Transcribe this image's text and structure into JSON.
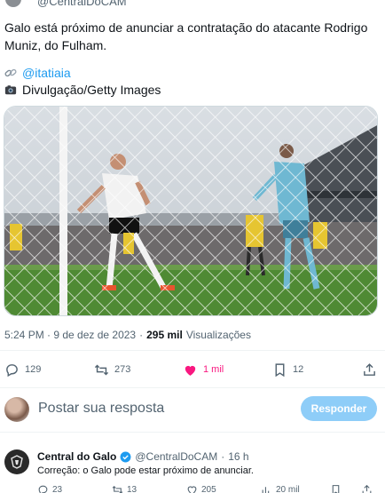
{
  "top": {
    "handle": "@CentralDoCAM"
  },
  "tweet": {
    "text": "Galo está próximo de anunciar a contratação do atacante Rodrigo Muniz, do Fulham.",
    "credit_link": "@itatiaia",
    "credit_photo": "Divulgação/Getty Images",
    "time": "5:24 PM · 9 de dez de 2023",
    "separator": "·",
    "views_count": "295 mil",
    "views_label": "Visualizações"
  },
  "actions": {
    "replies": "129",
    "retweets": "273",
    "likes": "1 mil",
    "bookmarks": "12"
  },
  "reply_box": {
    "placeholder": "Postar sua resposta",
    "button_label": "Responder"
  },
  "reply_tweet": {
    "name": "Central do Galo",
    "handle": "@CentralDoCAM",
    "separator": "·",
    "age": "16 h",
    "text": "Correção: o Galo pode estar próximo de anunciar.",
    "replies": "23",
    "retweets": "13",
    "likes": "205",
    "views": "20 mil"
  },
  "colors": {
    "accent": "#1d9bf0",
    "like": "#f91880",
    "reply_button": "#8ecdf8",
    "muted": "#536471",
    "text": "#0f1419"
  },
  "icons": [
    "link-icon",
    "camera-icon",
    "reply-icon",
    "retweet-icon",
    "heart-icon",
    "bookmark-icon",
    "share-icon",
    "verified-icon",
    "views-icon"
  ]
}
